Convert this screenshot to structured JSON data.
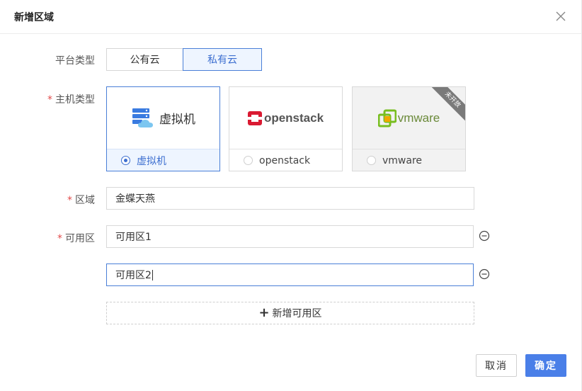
{
  "dialog": {
    "title": "新增区域"
  },
  "platform": {
    "label": "平台类型",
    "options": [
      "公有云",
      "私有云"
    ],
    "selected": "私有云"
  },
  "host": {
    "label": "主机类型",
    "cards": [
      {
        "logo_text": "虚拟机",
        "label": "虚拟机",
        "selected": true,
        "icon": "server-cloud-icon"
      },
      {
        "logo_text": "openstack",
        "label": "openstack",
        "selected": false,
        "icon": "openstack-logo-icon"
      },
      {
        "logo_text": "vmware",
        "label": "vmware",
        "selected": false,
        "disabled": true,
        "ribbon": "未开放",
        "icon": "vmware-logo-icon"
      }
    ]
  },
  "region": {
    "label": "区域",
    "value": "金蝶天燕"
  },
  "zones": {
    "label": "可用区",
    "items": [
      "可用区1",
      "可用区2"
    ],
    "add_label": "新增可用区"
  },
  "footer": {
    "cancel_label": "取消",
    "ok_label": "确定"
  },
  "colors": {
    "accent": "#4a7fe8",
    "required": "#e24b4b",
    "openstack_red": "#da1a32",
    "vmware_green": "#78be20"
  }
}
